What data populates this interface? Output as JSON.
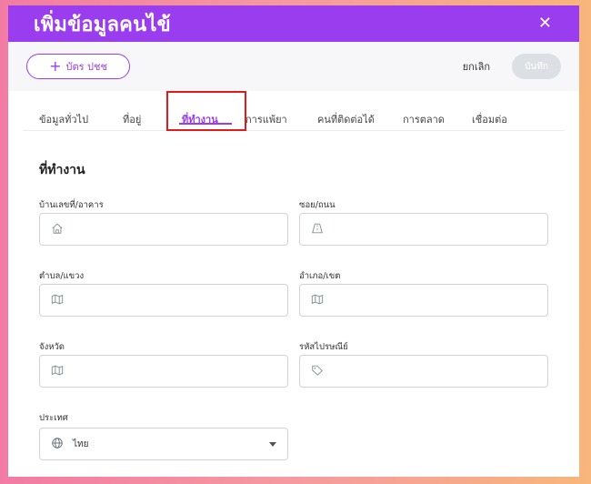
{
  "window": {
    "title": "เพิ่มข้อมูลคนไข้",
    "close_symbol": "✕"
  },
  "toolbar": {
    "idcard_plus": "+",
    "idcard_label": "บัตร ปชช",
    "cancel_label": "ยกเลิก",
    "save_label": "บันทึก"
  },
  "tabs": [
    {
      "label": "ข้อมูลทั่วไป",
      "active": false
    },
    {
      "label": "ที่อยู่",
      "active": false
    },
    {
      "label": "ที่ทำงาน",
      "active": true
    },
    {
      "label": "การแพ้ยา",
      "active": false
    },
    {
      "label": "คนที่ติดต่อได้",
      "active": false
    },
    {
      "label": "การตลาด",
      "active": false
    },
    {
      "label": "เชื่อมต่อ",
      "active": false
    }
  ],
  "section": {
    "title": "ที่ทำงาน"
  },
  "fields": {
    "house_no": {
      "label": "บ้านเลขที่/อาคาร",
      "value": "",
      "icon": "home-icon"
    },
    "street": {
      "label": "ซอย/ถนน",
      "value": "",
      "icon": "road-icon"
    },
    "subdistrict": {
      "label": "ตำบล/แขวง",
      "value": "",
      "icon": "map-icon"
    },
    "district": {
      "label": "อำเภอ/เขต",
      "value": "",
      "icon": "map-icon"
    },
    "province": {
      "label": "จังหวัด",
      "value": "",
      "icon": "map-icon"
    },
    "postcode": {
      "label": "รหัสไปรษณีย์",
      "value": "",
      "icon": "tag-icon"
    },
    "country": {
      "label": "ประเทศ",
      "value": "ไทย",
      "icon": "globe-icon"
    }
  },
  "colors": {
    "accent": "#9a3dee",
    "highlight_box": "#e01b1b",
    "save_disabled": "#dcdfe4"
  }
}
